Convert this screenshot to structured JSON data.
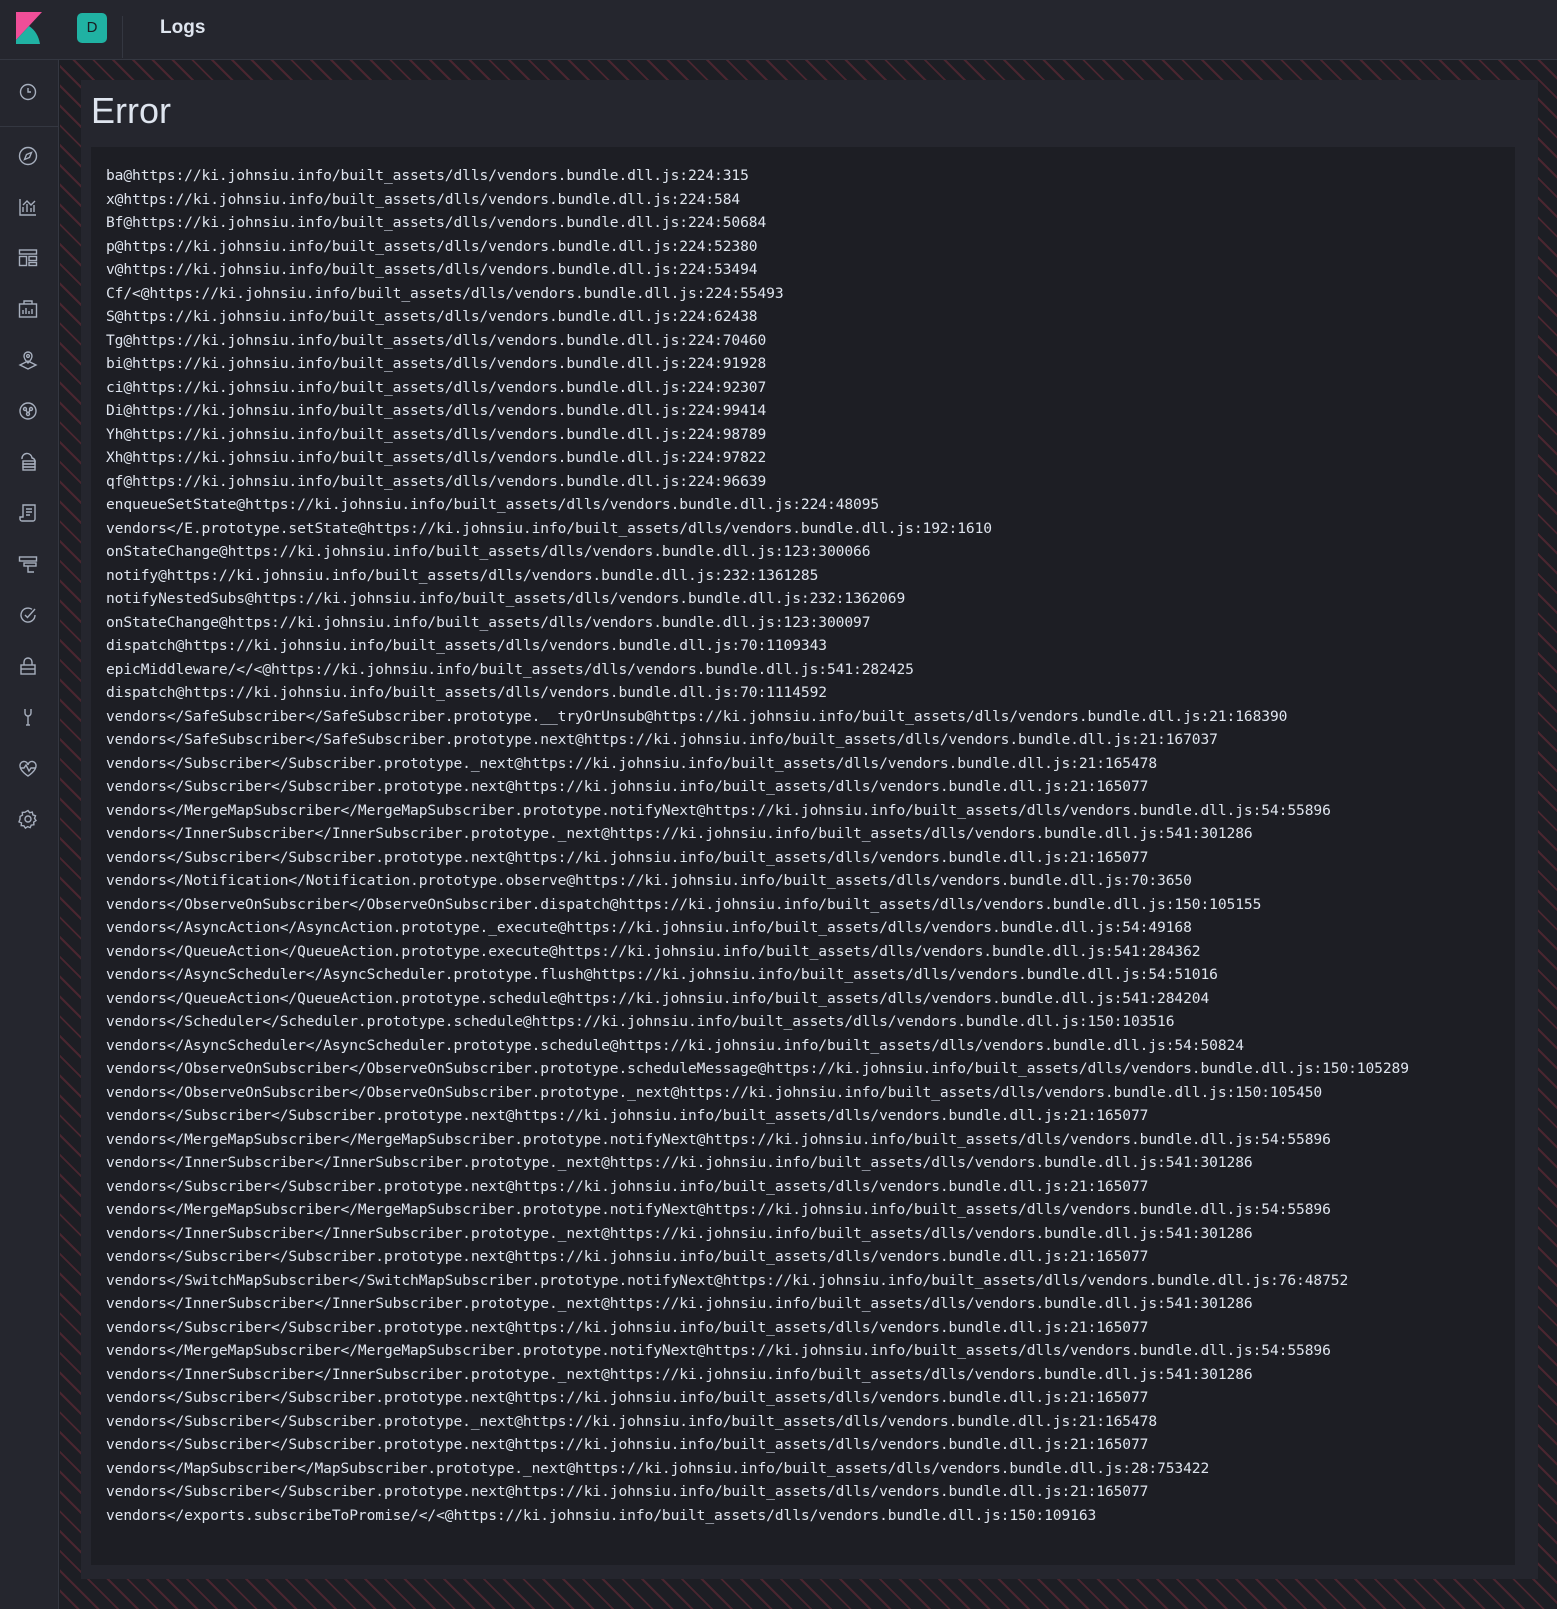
{
  "header": {
    "logo_icon": "kibana-logo-icon",
    "space_avatar_letter": "D",
    "page_title": "Logs"
  },
  "sidenav": {
    "items": [
      {
        "name": "recently-viewed",
        "icon": "clock-icon"
      },
      {
        "name": "discover",
        "icon": "compass-icon"
      },
      {
        "name": "visualize",
        "icon": "chart-icon"
      },
      {
        "name": "dashboard",
        "icon": "dashboard-icon"
      },
      {
        "name": "canvas",
        "icon": "canvas-icon"
      },
      {
        "name": "maps",
        "icon": "map-pin-icon"
      },
      {
        "name": "machine-learning",
        "icon": "ml-icon"
      },
      {
        "name": "infrastructure",
        "icon": "infrastructure-icon"
      },
      {
        "name": "logs",
        "icon": "logs-icon"
      },
      {
        "name": "apm",
        "icon": "apm-icon"
      },
      {
        "name": "uptime",
        "icon": "uptime-icon"
      },
      {
        "name": "siem",
        "icon": "lock-icon"
      },
      {
        "name": "dev-tools",
        "icon": "wrench-icon"
      },
      {
        "name": "stack-monitoring",
        "icon": "heartbeat-icon"
      },
      {
        "name": "management",
        "icon": "gear-icon"
      }
    ]
  },
  "error": {
    "title": "Error",
    "stack": [
      "ba@https://ki.johnsiu.info/built_assets/dlls/vendors.bundle.dll.js:224:315",
      "x@https://ki.johnsiu.info/built_assets/dlls/vendors.bundle.dll.js:224:584",
      "Bf@https://ki.johnsiu.info/built_assets/dlls/vendors.bundle.dll.js:224:50684",
      "p@https://ki.johnsiu.info/built_assets/dlls/vendors.bundle.dll.js:224:52380",
      "v@https://ki.johnsiu.info/built_assets/dlls/vendors.bundle.dll.js:224:53494",
      "Cf/<@https://ki.johnsiu.info/built_assets/dlls/vendors.bundle.dll.js:224:55493",
      "S@https://ki.johnsiu.info/built_assets/dlls/vendors.bundle.dll.js:224:62438",
      "Tg@https://ki.johnsiu.info/built_assets/dlls/vendors.bundle.dll.js:224:70460",
      "bi@https://ki.johnsiu.info/built_assets/dlls/vendors.bundle.dll.js:224:91928",
      "ci@https://ki.johnsiu.info/built_assets/dlls/vendors.bundle.dll.js:224:92307",
      "Di@https://ki.johnsiu.info/built_assets/dlls/vendors.bundle.dll.js:224:99414",
      "Yh@https://ki.johnsiu.info/built_assets/dlls/vendors.bundle.dll.js:224:98789",
      "Xh@https://ki.johnsiu.info/built_assets/dlls/vendors.bundle.dll.js:224:97822",
      "qf@https://ki.johnsiu.info/built_assets/dlls/vendors.bundle.dll.js:224:96639",
      "enqueueSetState@https://ki.johnsiu.info/built_assets/dlls/vendors.bundle.dll.js:224:48095",
      "vendors</E.prototype.setState@https://ki.johnsiu.info/built_assets/dlls/vendors.bundle.dll.js:192:1610",
      "onStateChange@https://ki.johnsiu.info/built_assets/dlls/vendors.bundle.dll.js:123:300066",
      "notify@https://ki.johnsiu.info/built_assets/dlls/vendors.bundle.dll.js:232:1361285",
      "notifyNestedSubs@https://ki.johnsiu.info/built_assets/dlls/vendors.bundle.dll.js:232:1362069",
      "onStateChange@https://ki.johnsiu.info/built_assets/dlls/vendors.bundle.dll.js:123:300097",
      "dispatch@https://ki.johnsiu.info/built_assets/dlls/vendors.bundle.dll.js:70:1109343",
      "epicMiddleware/</<@https://ki.johnsiu.info/built_assets/dlls/vendors.bundle.dll.js:541:282425",
      "dispatch@https://ki.johnsiu.info/built_assets/dlls/vendors.bundle.dll.js:70:1114592",
      "vendors</SafeSubscriber</SafeSubscriber.prototype.__tryOrUnsub@https://ki.johnsiu.info/built_assets/dlls/vendors.bundle.dll.js:21:168390",
      "vendors</SafeSubscriber</SafeSubscriber.prototype.next@https://ki.johnsiu.info/built_assets/dlls/vendors.bundle.dll.js:21:167037",
      "vendors</Subscriber</Subscriber.prototype._next@https://ki.johnsiu.info/built_assets/dlls/vendors.bundle.dll.js:21:165478",
      "vendors</Subscriber</Subscriber.prototype.next@https://ki.johnsiu.info/built_assets/dlls/vendors.bundle.dll.js:21:165077",
      "vendors</MergeMapSubscriber</MergeMapSubscriber.prototype.notifyNext@https://ki.johnsiu.info/built_assets/dlls/vendors.bundle.dll.js:54:55896",
      "vendors</InnerSubscriber</InnerSubscriber.prototype._next@https://ki.johnsiu.info/built_assets/dlls/vendors.bundle.dll.js:541:301286",
      "vendors</Subscriber</Subscriber.prototype.next@https://ki.johnsiu.info/built_assets/dlls/vendors.bundle.dll.js:21:165077",
      "vendors</Notification</Notification.prototype.observe@https://ki.johnsiu.info/built_assets/dlls/vendors.bundle.dll.js:70:3650",
      "vendors</ObserveOnSubscriber</ObserveOnSubscriber.dispatch@https://ki.johnsiu.info/built_assets/dlls/vendors.bundle.dll.js:150:105155",
      "vendors</AsyncAction</AsyncAction.prototype._execute@https://ki.johnsiu.info/built_assets/dlls/vendors.bundle.dll.js:54:49168",
      "vendors</QueueAction</QueueAction.prototype.execute@https://ki.johnsiu.info/built_assets/dlls/vendors.bundle.dll.js:541:284362",
      "vendors</AsyncScheduler</AsyncScheduler.prototype.flush@https://ki.johnsiu.info/built_assets/dlls/vendors.bundle.dll.js:54:51016",
      "vendors</QueueAction</QueueAction.prototype.schedule@https://ki.johnsiu.info/built_assets/dlls/vendors.bundle.dll.js:541:284204",
      "vendors</Scheduler</Scheduler.prototype.schedule@https://ki.johnsiu.info/built_assets/dlls/vendors.bundle.dll.js:150:103516",
      "vendors</AsyncScheduler</AsyncScheduler.prototype.schedule@https://ki.johnsiu.info/built_assets/dlls/vendors.bundle.dll.js:54:50824",
      "vendors</ObserveOnSubscriber</ObserveOnSubscriber.prototype.scheduleMessage@https://ki.johnsiu.info/built_assets/dlls/vendors.bundle.dll.js:150:105289",
      "vendors</ObserveOnSubscriber</ObserveOnSubscriber.prototype._next@https://ki.johnsiu.info/built_assets/dlls/vendors.bundle.dll.js:150:105450",
      "vendors</Subscriber</Subscriber.prototype.next@https://ki.johnsiu.info/built_assets/dlls/vendors.bundle.dll.js:21:165077",
      "vendors</MergeMapSubscriber</MergeMapSubscriber.prototype.notifyNext@https://ki.johnsiu.info/built_assets/dlls/vendors.bundle.dll.js:54:55896",
      "vendors</InnerSubscriber</InnerSubscriber.prototype._next@https://ki.johnsiu.info/built_assets/dlls/vendors.bundle.dll.js:541:301286",
      "vendors</Subscriber</Subscriber.prototype.next@https://ki.johnsiu.info/built_assets/dlls/vendors.bundle.dll.js:21:165077",
      "vendors</MergeMapSubscriber</MergeMapSubscriber.prototype.notifyNext@https://ki.johnsiu.info/built_assets/dlls/vendors.bundle.dll.js:54:55896",
      "vendors</InnerSubscriber</InnerSubscriber.prototype._next@https://ki.johnsiu.info/built_assets/dlls/vendors.bundle.dll.js:541:301286",
      "vendors</Subscriber</Subscriber.prototype.next@https://ki.johnsiu.info/built_assets/dlls/vendors.bundle.dll.js:21:165077",
      "vendors</SwitchMapSubscriber</SwitchMapSubscriber.prototype.notifyNext@https://ki.johnsiu.info/built_assets/dlls/vendors.bundle.dll.js:76:48752",
      "vendors</InnerSubscriber</InnerSubscriber.prototype._next@https://ki.johnsiu.info/built_assets/dlls/vendors.bundle.dll.js:541:301286",
      "vendors</Subscriber</Subscriber.prototype.next@https://ki.johnsiu.info/built_assets/dlls/vendors.bundle.dll.js:21:165077",
      "vendors</MergeMapSubscriber</MergeMapSubscriber.prototype.notifyNext@https://ki.johnsiu.info/built_assets/dlls/vendors.bundle.dll.js:54:55896",
      "vendors</InnerSubscriber</InnerSubscriber.prototype._next@https://ki.johnsiu.info/built_assets/dlls/vendors.bundle.dll.js:541:301286",
      "vendors</Subscriber</Subscriber.prototype.next@https://ki.johnsiu.info/built_assets/dlls/vendors.bundle.dll.js:21:165077",
      "vendors</Subscriber</Subscriber.prototype._next@https://ki.johnsiu.info/built_assets/dlls/vendors.bundle.dll.js:21:165478",
      "vendors</Subscriber</Subscriber.prototype.next@https://ki.johnsiu.info/built_assets/dlls/vendors.bundle.dll.js:21:165077",
      "vendors</MapSubscriber</MapSubscriber.prototype._next@https://ki.johnsiu.info/built_assets/dlls/vendors.bundle.dll.js:28:753422",
      "vendors</Subscriber</Subscriber.prototype.next@https://ki.johnsiu.info/built_assets/dlls/vendors.bundle.dll.js:21:165077",
      "vendors</exports.subscribeToPromise/</<@https://ki.johnsiu.info/built_assets/dlls/vendors.bundle.dll.js:150:109163"
    ]
  },
  "colors": {
    "chrome_bg": "#25262e",
    "page_bg": "#1d1e24",
    "text": "#dfe5ef",
    "accent": "#20b2a3",
    "danger_stripe": "#4a2630"
  }
}
